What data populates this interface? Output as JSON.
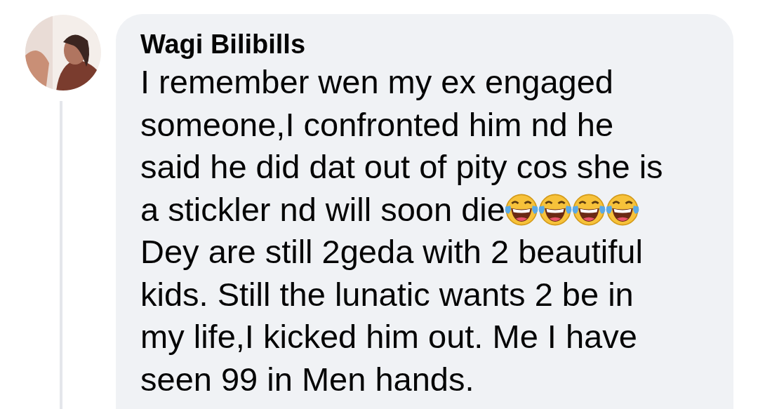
{
  "comment": {
    "author": "Wagi Bilibills",
    "lines": [
      {
        "text": "I remember wen my ex engaged"
      },
      {
        "text": "someone,I confronted him nd he"
      },
      {
        "text": "said he did dat out of pity cos she is"
      },
      {
        "text": "a stickler nd will soon die",
        "emojis": [
          {
            "kind": "laughing-tears"
          },
          {
            "kind": "laughing-tears"
          },
          {
            "kind": "laughing-tears"
          },
          {
            "kind": "laughing-tears"
          }
        ]
      },
      {
        "text": "Dey are still 2geda with 2 beautiful"
      },
      {
        "text": "kids. Still the lunatic wants 2 be in"
      },
      {
        "text": "my life,I kicked him out. Me I have"
      },
      {
        "text": "seen 99 in Men hands."
      }
    ]
  }
}
